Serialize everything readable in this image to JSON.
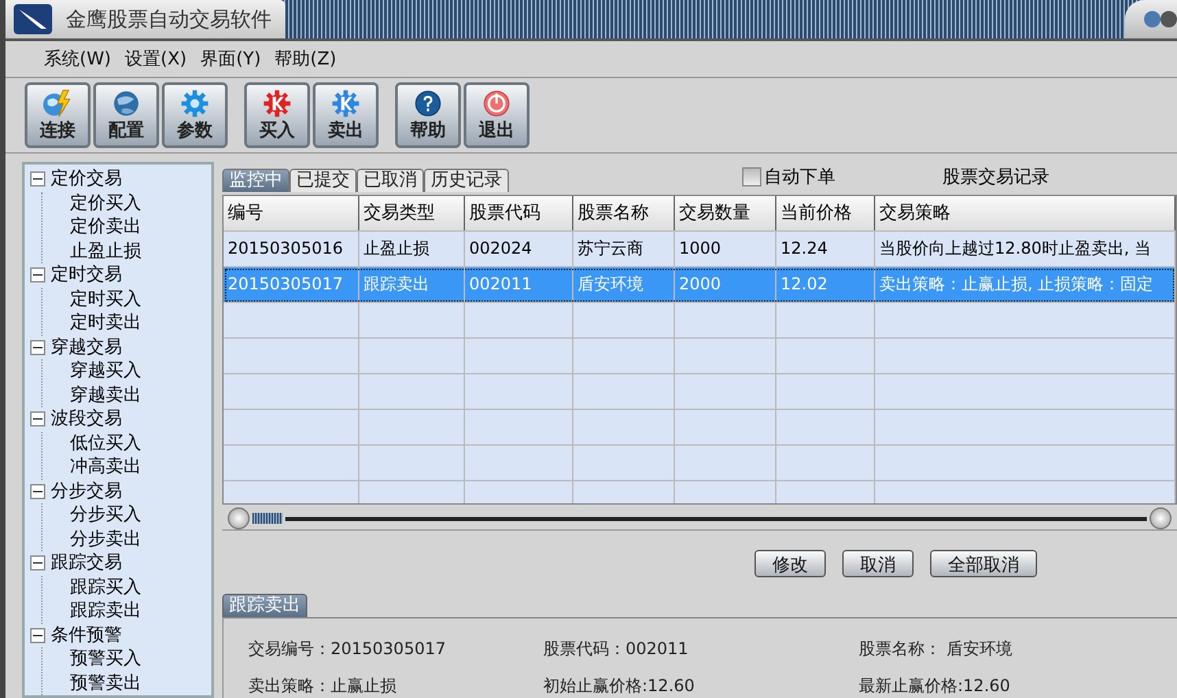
{
  "window": {
    "title": "金鹰股票自动交易软件"
  },
  "menu": [
    "系统(W)",
    "设置(X)",
    "界面(Y)",
    "帮助(Z)"
  ],
  "toolbar": [
    [
      {
        "label": "连接",
        "kind": "connect"
      },
      {
        "label": "配置",
        "kind": "config"
      },
      {
        "label": "参数",
        "kind": "params"
      }
    ],
    [
      {
        "label": "买入",
        "kind": "buy"
      },
      {
        "label": "卖出",
        "kind": "sell"
      }
    ],
    [
      {
        "label": "帮助",
        "kind": "help"
      },
      {
        "label": "退出",
        "kind": "exit"
      }
    ]
  ],
  "tree": [
    {
      "label": "定价交易",
      "expanded": true,
      "children": [
        {
          "label": "定价买入"
        },
        {
          "label": "定价卖出"
        },
        {
          "label": "止盈止损"
        }
      ]
    },
    {
      "label": "定时交易",
      "expanded": true,
      "children": [
        {
          "label": "定时买入"
        },
        {
          "label": "定时卖出"
        }
      ]
    },
    {
      "label": "穿越交易",
      "expanded": true,
      "children": [
        {
          "label": "穿越买入"
        },
        {
          "label": "穿越卖出"
        }
      ]
    },
    {
      "label": "波段交易",
      "expanded": true,
      "children": [
        {
          "label": "低位买入"
        },
        {
          "label": "冲高卖出"
        }
      ]
    },
    {
      "label": "分步交易",
      "expanded": true,
      "children": [
        {
          "label": "分步买入"
        },
        {
          "label": "分步卖出"
        }
      ]
    },
    {
      "label": "跟踪交易",
      "expanded": true,
      "children": [
        {
          "label": "跟踪买入"
        },
        {
          "label": "跟踪卖出"
        }
      ]
    },
    {
      "label": "条件预警",
      "expanded": true,
      "children": [
        {
          "label": "预警买入"
        },
        {
          "label": "预警卖出"
        }
      ]
    }
  ],
  "tabs": [
    {
      "label": "监控中",
      "selected": true
    },
    {
      "label": "已提交",
      "selected": false
    },
    {
      "label": "已取消",
      "selected": false
    },
    {
      "label": "历史记录",
      "selected": false
    }
  ],
  "auto_order": {
    "label": "自动下单",
    "checked": false
  },
  "records_title": "股票交易记录",
  "table": {
    "columns": [
      "编号",
      "交易类型",
      "股票代码",
      "股票名称",
      "交易数量",
      "当前价格",
      "交易策略"
    ],
    "rows": [
      {
        "cells": [
          "20150305016",
          "止盈止损",
          "002024",
          "苏宁云商",
          "1000",
          "12.24",
          "当股价向上越过12.80时止盈卖出, 当"
        ],
        "selected": false
      },
      {
        "cells": [
          "20150305017",
          "跟踪卖出",
          "002011",
          "盾安环境",
          "2000",
          "12.02",
          "卖出策略：止赢止损, 止损策略：固定"
        ],
        "selected": true
      }
    ]
  },
  "buttons": [
    "修改",
    "取消",
    "全部取消"
  ],
  "detail": {
    "tab": "跟踪卖出",
    "fields": [
      [
        "交易编号：20150305017",
        "股票代码：002011",
        "股票名称：  盾安环境"
      ],
      [
        "卖出策略：止赢止损",
        "初始止赢价格:12.60",
        "最新止赢价格:12.60"
      ]
    ]
  }
}
